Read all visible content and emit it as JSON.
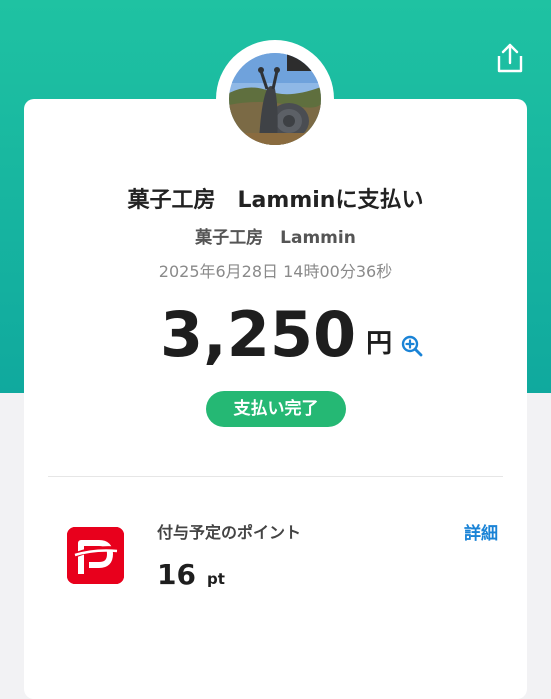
{
  "header": {
    "share_icon": "share-icon"
  },
  "merchant": {
    "avatar_icon": "merchant-avatar",
    "title": "菓子工房　Lamminに支払い",
    "name": "菓子工房　Lammin",
    "datetime": "2025年6月28日 14時00分36秒"
  },
  "payment": {
    "amount": "3,250",
    "currency": "円",
    "zoom_icon": "zoom-in-icon",
    "status": "支払い完了"
  },
  "points": {
    "logo_icon": "paypay-logo",
    "label": "付与予定のポイント",
    "value": "16",
    "unit": "pt",
    "detail_link": "詳細"
  },
  "colors": {
    "header_gradient_top": "#1fc2a2",
    "header_gradient_bottom": "#10a99e",
    "status_green": "#25b874",
    "link_blue": "#1a83d6",
    "paypay_red": "#e8001c"
  }
}
